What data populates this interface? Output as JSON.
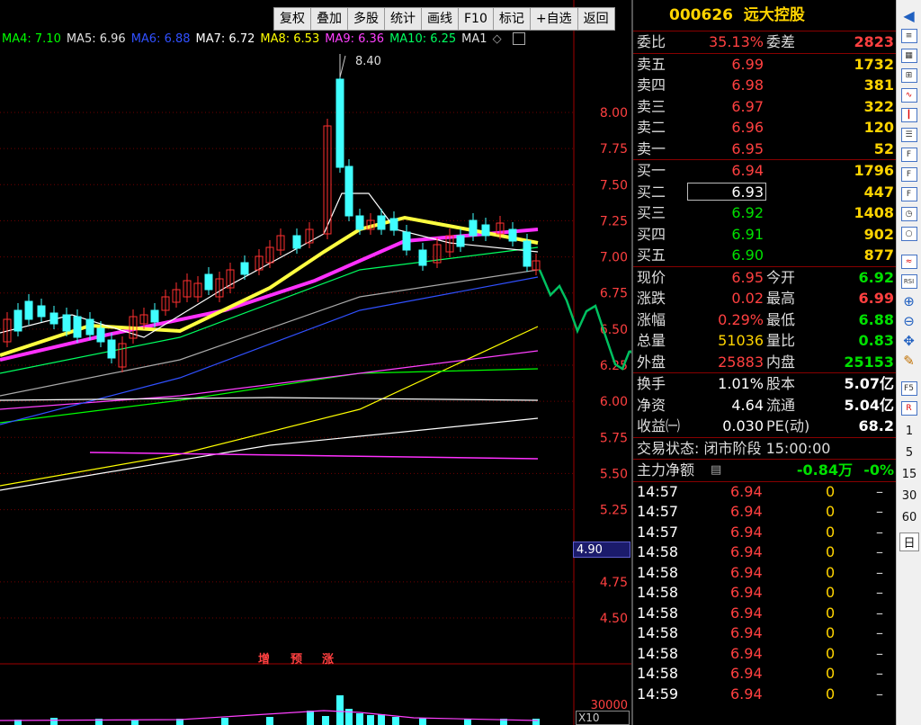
{
  "toolbar": {
    "buttons": [
      "复权",
      "叠加",
      "多股",
      "统计",
      "画线",
      "F10",
      "标记",
      "+自选",
      "返回"
    ]
  },
  "ma_legend": [
    {
      "label": "MA4: 7.10",
      "color": "#00ff00"
    },
    {
      "label": "MA5: 6.96",
      "color": "#e0e0e0"
    },
    {
      "label": "MA6: 6.88",
      "color": "#3050ff"
    },
    {
      "label": "MA7: 6.72",
      "color": "#ffffff"
    },
    {
      "label": "MA8: 6.53",
      "color": "#ffff00"
    },
    {
      "label": "MA9: 6.36",
      "color": "#ff40ff"
    },
    {
      "label": "MA10: 6.25",
      "color": "#00ff60"
    },
    {
      "label": "MA1",
      "color": "#e0e0e0"
    }
  ],
  "chart_data": {
    "type": "candlestick",
    "y_ticks": [
      "8.00",
      "7.75",
      "7.50",
      "7.25",
      "7.00",
      "6.75",
      "6.50",
      "6.25",
      "6.00",
      "5.75",
      "5.50",
      "5.25",
      "4.75",
      "4.50"
    ],
    "high_label": "8.40",
    "current_price_box": "4.90",
    "volume_tick": "30000",
    "volume_scale": "X10",
    "marks": [
      "增",
      "预",
      "涨"
    ]
  },
  "quote": {
    "code": "000626",
    "name": "远大控股",
    "weibi_label": "委比",
    "weibi": "35.13%",
    "weicha_label": "委差",
    "weicha": "2823",
    "asks": [
      {
        "label": "卖五",
        "price": "6.99",
        "vol": "1732"
      },
      {
        "label": "卖四",
        "price": "6.98",
        "vol": "381"
      },
      {
        "label": "卖三",
        "price": "6.97",
        "vol": "322"
      },
      {
        "label": "卖二",
        "price": "6.96",
        "vol": "120"
      },
      {
        "label": "卖一",
        "price": "6.95",
        "vol": "52"
      }
    ],
    "bids": [
      {
        "label": "买一",
        "price": "6.94",
        "vol": "1796",
        "color": "red"
      },
      {
        "label": "买二",
        "price": "6.93",
        "vol": "447",
        "color": "white"
      },
      {
        "label": "买三",
        "price": "6.92",
        "vol": "1408",
        "color": "green"
      },
      {
        "label": "买四",
        "price": "6.91",
        "vol": "902",
        "color": "green"
      },
      {
        "label": "买五",
        "price": "6.90",
        "vol": "877",
        "color": "green"
      }
    ],
    "stats": [
      {
        "l1": "现价",
        "v1": "6.95",
        "c1": "red",
        "l2": "今开",
        "v2": "6.92",
        "c2": "green"
      },
      {
        "l1": "涨跌",
        "v1": "0.02",
        "c1": "red",
        "l2": "最高",
        "v2": "6.99",
        "c2": "red"
      },
      {
        "l1": "涨幅",
        "v1": "0.29%",
        "c1": "red",
        "l2": "最低",
        "v2": "6.88",
        "c2": "green"
      },
      {
        "l1": "总量",
        "v1": "51036",
        "c1": "yellow",
        "l2": "量比",
        "v2": "0.83",
        "c2": "green"
      },
      {
        "l1": "外盘",
        "v1": "25883",
        "c1": "red",
        "l2": "内盘",
        "v2": "25153",
        "c2": "green"
      }
    ],
    "stats2": [
      {
        "l1": "换手",
        "v1": "1.01%",
        "l2": "股本",
        "v2": "5.07亿"
      },
      {
        "l1": "净资",
        "v1": "4.64",
        "l2": "流通",
        "v2": "5.04亿"
      },
      {
        "l1": "收益㈠",
        "v1": "0.030",
        "l2": "PE(动)",
        "v2": "68.2"
      }
    ],
    "trade_status": "交易状态: 闭市阶段 15:00:00",
    "main_flow_label": "主力净额",
    "main_flow_value": "-0.84万",
    "main_flow_pct": "-0%",
    "ticks": [
      {
        "time": "14:57",
        "price": "6.94",
        "vol": "0",
        "dir": "–"
      },
      {
        "time": "14:57",
        "price": "6.94",
        "vol": "0",
        "dir": "–"
      },
      {
        "time": "14:57",
        "price": "6.94",
        "vol": "0",
        "dir": "–"
      },
      {
        "time": "14:58",
        "price": "6.94",
        "vol": "0",
        "dir": "–"
      },
      {
        "time": "14:58",
        "price": "6.94",
        "vol": "0",
        "dir": "–"
      },
      {
        "time": "14:58",
        "price": "6.94",
        "vol": "0",
        "dir": "–"
      },
      {
        "time": "14:58",
        "price": "6.94",
        "vol": "0",
        "dir": "–"
      },
      {
        "time": "14:58",
        "price": "6.94",
        "vol": "0",
        "dir": "–"
      },
      {
        "time": "14:58",
        "price": "6.94",
        "vol": "0",
        "dir": "–"
      },
      {
        "time": "14:58",
        "price": "6.94",
        "vol": "0",
        "dir": "–"
      },
      {
        "time": "14:59",
        "price": "6.94",
        "vol": "0",
        "dir": "–"
      }
    ]
  },
  "side_bar": {
    "numbers": [
      "1",
      "5",
      "15",
      "30",
      "60",
      "日"
    ]
  }
}
